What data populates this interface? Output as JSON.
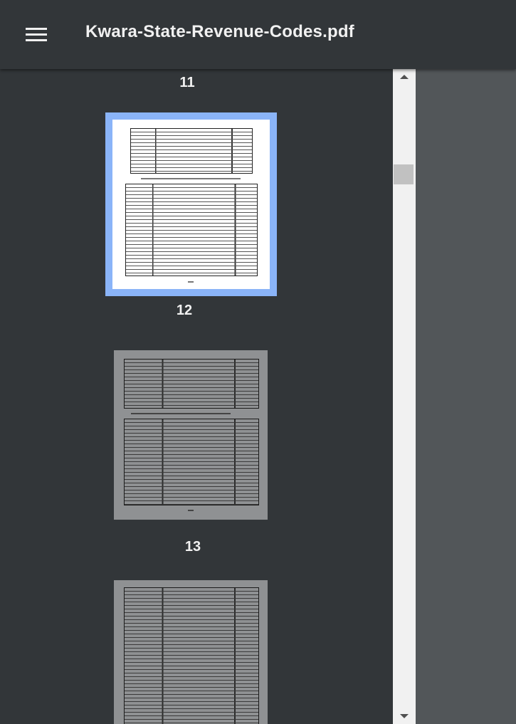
{
  "toolbar": {
    "menu_icon": "hamburger-menu-icon",
    "title": "Kwara-State-Revenue-Codes.pdf"
  },
  "sidebar": {
    "pages": [
      {
        "number": "11"
      },
      {
        "number": "12",
        "selected": true
      },
      {
        "number": "13"
      }
    ]
  },
  "colors": {
    "toolbar_bg": "#323639",
    "sidebar_bg": "#323639",
    "viewer_bg": "#525659",
    "selection": "#8ab4f8",
    "scrollbar_track": "#f1f1f1",
    "scrollbar_thumb": "#c1c1c1"
  }
}
